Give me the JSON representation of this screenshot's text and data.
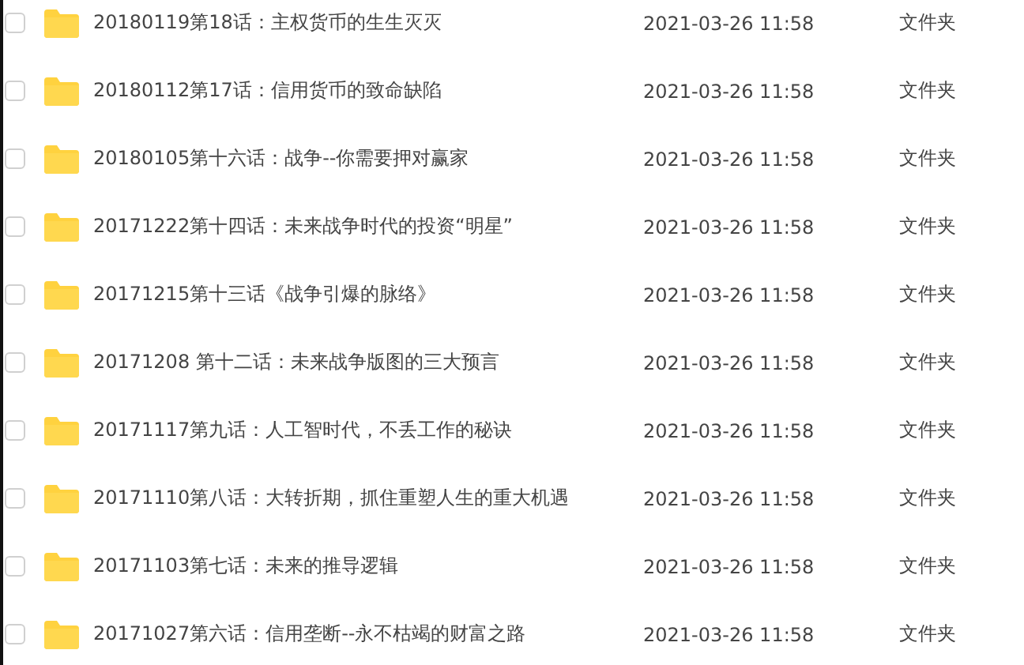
{
  "files": [
    {
      "name": "20180119第18话：主权货币的生生灭灭",
      "modified": "2021-03-26 11:58",
      "type": "文件夹",
      "checked": false
    },
    {
      "name": "20180112第17话：信用货币的致命缺陷",
      "modified": "2021-03-26 11:58",
      "type": "文件夹",
      "checked": false
    },
    {
      "name": "20180105第十六话：战争--你需要押对赢家",
      "modified": "2021-03-26 11:58",
      "type": "文件夹",
      "checked": false
    },
    {
      "name": "20171222第十四话：未来战争时代的投资“明星”",
      "modified": "2021-03-26 11:58",
      "type": "文件夹",
      "checked": false
    },
    {
      "name": "20171215第十三话《战争引爆的脉络》",
      "modified": "2021-03-26 11:58",
      "type": "文件夹",
      "checked": false
    },
    {
      "name": "20171208 第十二话：未来战争版图的三大预言",
      "modified": "2021-03-26 11:58",
      "type": "文件夹",
      "checked": false
    },
    {
      "name": "20171117第九话：人工智时代，不丢工作的秘诀",
      "modified": "2021-03-26 11:58",
      "type": "文件夹",
      "checked": false
    },
    {
      "name": "20171110第八话：大转折期，抓住重塑人生的重大机遇",
      "modified": "2021-03-26 11:58",
      "type": "文件夹",
      "checked": false
    },
    {
      "name": "20171103第七话：未来的推导逻辑",
      "modified": "2021-03-26 11:58",
      "type": "文件夹",
      "checked": false
    },
    {
      "name": "20171027第六话：信用垄断--永不枯竭的财富之路",
      "modified": "2021-03-26 11:58",
      "type": "文件夹",
      "checked": false
    }
  ]
}
